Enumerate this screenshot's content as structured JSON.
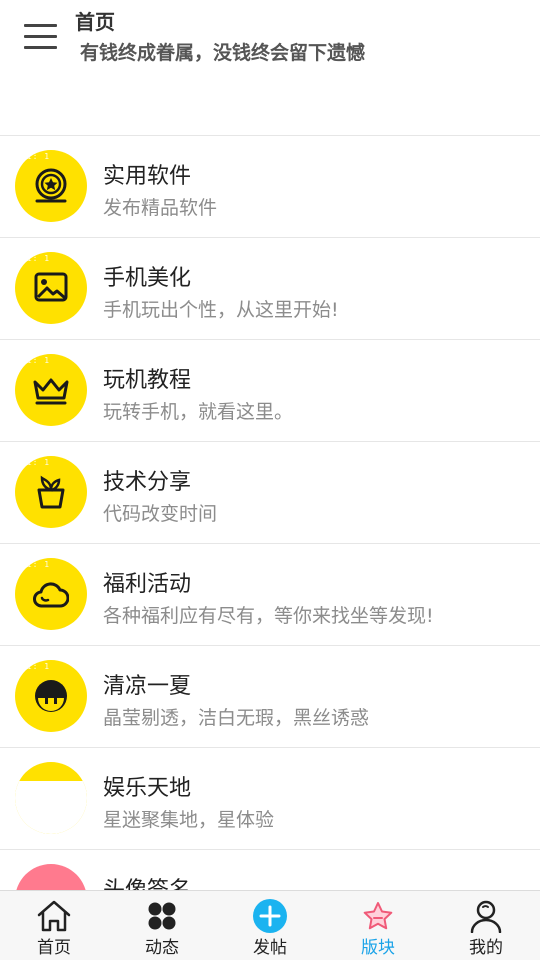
{
  "header": {
    "title": "首页",
    "subtitle": "有钱终成眷属，没钱终会留下遗憾"
  },
  "colors": {
    "icon_yellow": "#ffe100",
    "icon_pink": "#ff7a8e",
    "active_tab": "#1aa3e8",
    "add_button": "#1bb3f0"
  },
  "list": [
    {
      "name": "实用软件",
      "desc": "发布精品软件",
      "icon": "medal-icon",
      "badge": "1"
    },
    {
      "name": "手机美化",
      "desc": "手机玩出个性，从这里开始!",
      "icon": "image-icon",
      "badge": "1"
    },
    {
      "name": "玩机教程",
      "desc": "玩转手机，就看这里。",
      "icon": "crown-icon",
      "badge": "1"
    },
    {
      "name": "技术分享",
      "desc": "代码改变时间",
      "icon": "plant-pot-icon",
      "badge": "1"
    },
    {
      "name": "福利活动",
      "desc": "各种福利应有尽有，等你来找坐等发现!",
      "icon": "cloud-icon",
      "badge": "1"
    },
    {
      "name": "清凉一夏",
      "desc": "晶莹剔透，洁白无瑕，黑丝诱惑",
      "icon": "face-icon",
      "badge": "1"
    },
    {
      "name": "娱乐天地",
      "desc": "星迷聚集地，星体验",
      "icon": "half-circle-icon"
    },
    {
      "name": "头像签名",
      "desc": "",
      "icon": "card-icon"
    }
  ],
  "tabs": [
    {
      "label": "首页",
      "icon": "home-icon"
    },
    {
      "label": "动态",
      "icon": "grid-icon"
    },
    {
      "label": "发帖",
      "icon": "add-circle-icon"
    },
    {
      "label": "版块",
      "icon": "star-icon",
      "active": true
    },
    {
      "label": "我的",
      "icon": "user-icon"
    }
  ]
}
